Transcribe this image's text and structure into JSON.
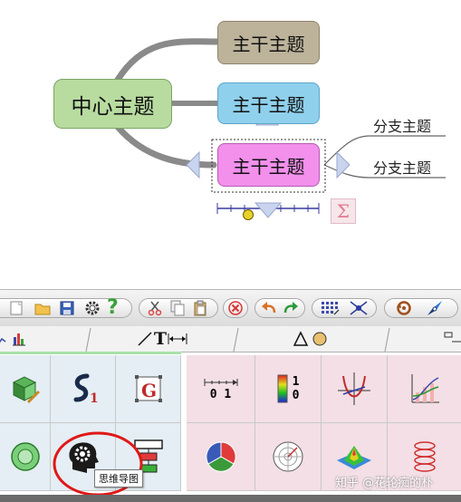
{
  "mindmap": {
    "center_topic": "中心主题",
    "main_topics": [
      "主干主题",
      "主干主题",
      "主干主题"
    ],
    "sub_topics": [
      "分支主题",
      "分支主题"
    ],
    "colors": {
      "center": "#b8dba0",
      "topic1": "#bdb39b",
      "topic2": "#8fd0ec",
      "topic3": "#f290ec",
      "connector": "#8a8a8a"
    }
  },
  "toolbar": {
    "buttons": [
      "new-file",
      "open-folder",
      "save",
      "settings",
      "help",
      "cut",
      "copy",
      "paste",
      "delete",
      "undo",
      "redo",
      "grid",
      "transform",
      "rotate",
      "compass"
    ]
  },
  "tabs": {
    "labels": [
      "T",
      "",
      ""
    ]
  },
  "tooltip": {
    "text": "思维导图"
  },
  "right_panel": {
    "ruler_label": "0 1",
    "gradient_top": "1",
    "gradient_bottom": "0"
  },
  "watermark": {
    "text": "知乎 @花轮痴的朴"
  }
}
